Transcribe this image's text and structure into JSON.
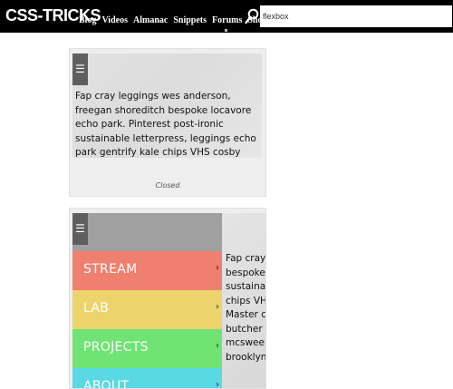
{
  "header": {
    "logo": "CSS-TRICKS",
    "nav": [
      "Blog",
      "Videos",
      "Almanac",
      "Snippets",
      "Forums",
      "Shop"
    ],
    "search_value": "flexbox",
    "search_icon": "search-icon"
  },
  "demo1": {
    "menu_icon": "☰",
    "text": "Fap cray leggings wes anderson, freegan shoreditch bespoke locavore echo park. Pinterest post-ironic sustainable letterpress, leggings echo park gentrify kale chips VHS cosby sweater flexitarian chillwave",
    "status": "Closed"
  },
  "demo2": {
    "menu_icon": "☰",
    "menu_items": [
      {
        "label": "STREAM",
        "color": "#ef7f6e"
      },
      {
        "label": "LAB",
        "color": "#ecd36b"
      },
      {
        "label": "PROJECTS",
        "color": "#6fe474"
      },
      {
        "label": "ABOUT",
        "color": "#5ad8e4"
      }
    ],
    "chevron": "›",
    "content_lines": [
      "Fap cray leg",
      "bespoke lo",
      "sustainabl",
      "chips VHS c",
      "Master clea",
      "butcher rea",
      "mcsweeney",
      "brooklyn ne"
    ]
  }
}
